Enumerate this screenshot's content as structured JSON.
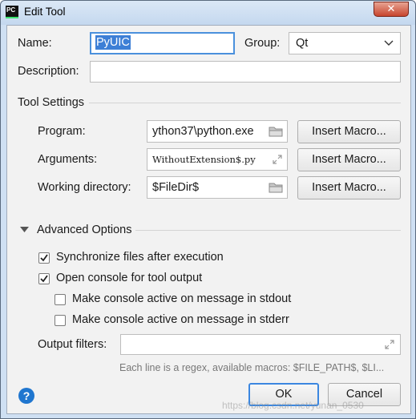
{
  "window": {
    "title": "Edit Tool",
    "close_label": "✕"
  },
  "form": {
    "name_label": "Name:",
    "name_value": "PyUIC",
    "group_label": "Group:",
    "group_value": "Qt",
    "description_label": "Description:",
    "description_value": ""
  },
  "tool_settings": {
    "section_label": "Tool Settings",
    "program_label": "Program:",
    "program_value": "ython37\\python.exe",
    "arguments_label": "Arguments:",
    "arguments_value": "WithoutExtension$.py",
    "working_dir_label": "Working directory:",
    "working_dir_value": "$FileDir$",
    "insert_macro_label": "Insert Macro..."
  },
  "advanced": {
    "section_label": "Advanced Options",
    "sync_files_label": "Synchronize files after execution",
    "sync_files_checked": true,
    "open_console_label": "Open console for tool output",
    "open_console_checked": true,
    "console_stdout_label": "Make console active on message in stdout",
    "console_stdout_checked": false,
    "console_stderr_label": "Make console active on message in stderr",
    "console_stderr_checked": false,
    "output_filters_label": "Output filters:",
    "output_filters_value": "",
    "hint": "Each line is a regex, available macros: $FILE_PATH$, $LI..."
  },
  "footer": {
    "help_label": "?",
    "ok_label": "OK",
    "cancel_label": "Cancel",
    "watermark": "https://blog.csdn.net/yunan_0530"
  },
  "colors": {
    "accent": "#2f7fd9",
    "selection": "#3d7fd6",
    "help": "#1f76cf"
  }
}
